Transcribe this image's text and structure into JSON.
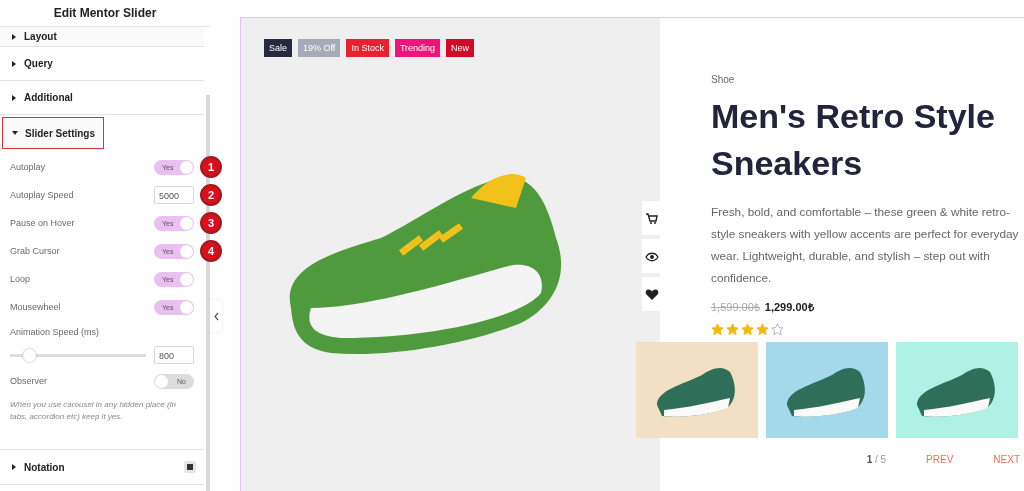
{
  "panel": {
    "title": "Edit Mentor Slider",
    "sections_before": [
      {
        "label": "Layout",
        "expanded": false
      },
      {
        "label": "Query",
        "expanded": false
      },
      {
        "label": "Additional",
        "expanded": false
      }
    ],
    "active_section": {
      "label": "Slider Settings",
      "expanded": true,
      "highlighted": true
    },
    "settings": [
      {
        "kind": "toggle",
        "label": "Autoplay",
        "on": true,
        "on_text": "Yes",
        "marker": "1"
      },
      {
        "kind": "number",
        "label": "Autoplay Speed",
        "value": "5000",
        "marker": "2"
      },
      {
        "kind": "toggle",
        "label": "Pause on Hover",
        "on": true,
        "on_text": "Yes",
        "marker": "3"
      },
      {
        "kind": "toggle",
        "label": "Grab Cursor",
        "on": true,
        "on_text": "Yes",
        "marker": "4"
      },
      {
        "kind": "toggle",
        "label": "Loop",
        "on": true,
        "on_text": "Yes"
      },
      {
        "kind": "toggle",
        "label": "Mousewheel",
        "on": true,
        "on_text": "Yes"
      },
      {
        "kind": "slider",
        "label": "Animation Speed (ms)",
        "level": 0.14,
        "value": "800"
      },
      {
        "kind": "toggle",
        "label": "Observer",
        "on": false,
        "on_text": "No"
      },
      {
        "kind": "note",
        "label": "When you use carousel in any hidden place (in tabs, accordion etc) keep it yes."
      }
    ],
    "sections_after": [
      {
        "label": "Notation",
        "expanded": false
      }
    ]
  },
  "product": {
    "badges": [
      {
        "label": "Sale",
        "color": "#262a40"
      },
      {
        "label": "19% Off",
        "color": "#a6abb8"
      },
      {
        "label": "In Stock",
        "color": "#e8202f"
      },
      {
        "label": "Trending",
        "color": "#f0137a"
      },
      {
        "label": "New",
        "color": "#d10a2a"
      }
    ],
    "category": "Shoe",
    "title": "Men's Retro Style Sneakers",
    "description": "Fresh, bold, and comfortable – these green & white retro-style sneakers with yellow accents are perfect for everyday wear. Lightweight, durable, and stylish – step out with confidence.",
    "old_price": "1,599.00₺",
    "price": "1,299.00₺",
    "stars": 4,
    "thumbnails": [
      {
        "color": "#f3dfc3"
      },
      {
        "color": "#a6d8eb"
      },
      {
        "color": "#aef2e6"
      }
    ],
    "pagination": {
      "current": "1",
      "total": "/ 5",
      "prev": "PREV",
      "next": "NEXT"
    }
  }
}
